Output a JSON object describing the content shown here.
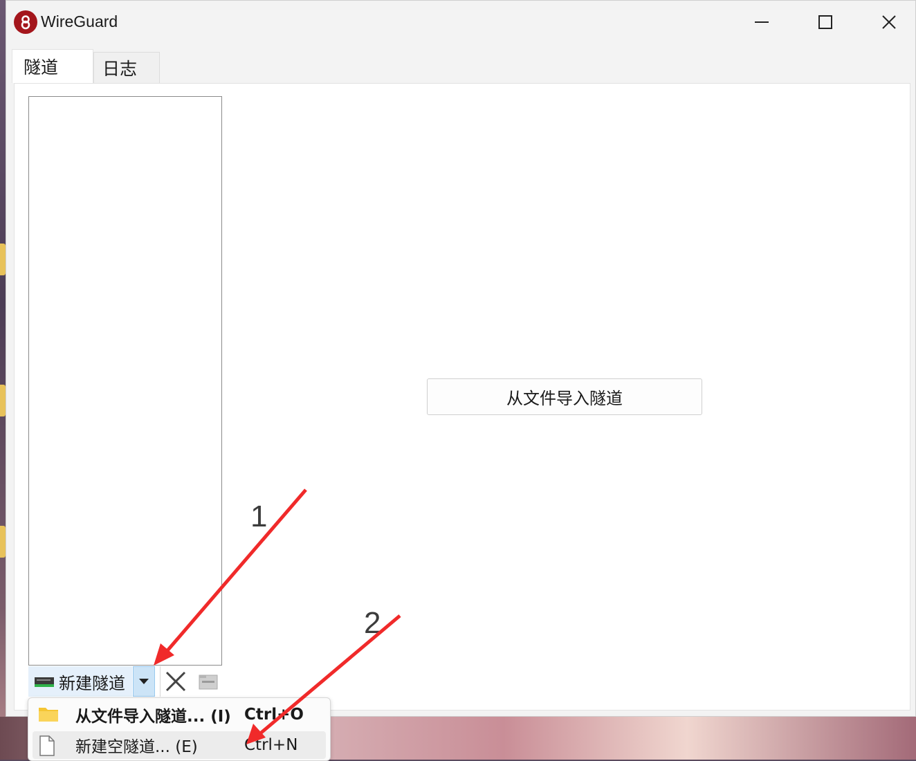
{
  "window": {
    "title": "WireGuard",
    "app_icon": "wireguard-logo-icon",
    "controls": [
      "minimize-icon",
      "maximize-icon",
      "close-icon"
    ]
  },
  "tabs": [
    {
      "label": "隧道",
      "active": true
    },
    {
      "label": "日志",
      "active": false
    }
  ],
  "toolbar": {
    "new_tunnel_label": "新建隧道",
    "icons": [
      "network-adapter-icon",
      "chevron-down-icon",
      "delete-x-icon",
      "export-zip-icon"
    ]
  },
  "main": {
    "import_button_label": "从文件导入隧道"
  },
  "menu": {
    "items": [
      {
        "label": "从文件导入隧道... (I)",
        "shortcut": "Ctrl+O",
        "icon": "folder-icon",
        "bold": true
      },
      {
        "label": "新建空隧道... (E)",
        "shortcut": "Ctrl+N",
        "icon": "blank-file-icon",
        "bold": false
      }
    ]
  },
  "annotations": {
    "step1": "1",
    "step2": "2",
    "arrow_color": "#f02a2a"
  },
  "colors": {
    "accent_selected": "#cce4f7",
    "brand": "#a4161c"
  }
}
